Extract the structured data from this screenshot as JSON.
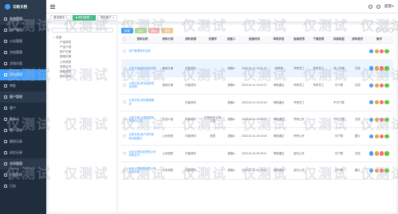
{
  "app": {
    "logo_text": "云帆文档"
  },
  "sidebar": {
    "items": [
      {
        "label": "系统管理",
        "state": "group"
      },
      {
        "label": "用户管理",
        "state": "normal"
      },
      {
        "label": "公告管理",
        "state": "normal"
      },
      {
        "label": "文档管理",
        "state": "normal"
      },
      {
        "label": "文档分类",
        "state": "normal"
      },
      {
        "label": "资料管理",
        "state": "active-sub"
      },
      {
        "label": "审批",
        "state": "normal"
      },
      {
        "label": "客户管理",
        "state": "group"
      },
      {
        "label": "客户",
        "state": "normal"
      },
      {
        "label": "联系人",
        "state": "normal"
      },
      {
        "label": "客户动态",
        "state": "normal"
      },
      {
        "label": "跟进记录",
        "state": "normal"
      },
      {
        "label": "成交记录",
        "state": "normal"
      },
      {
        "label": "合同管理",
        "state": "group"
      },
      {
        "label": "回款管理",
        "state": "normal"
      },
      {
        "label": "日志",
        "state": "normal"
      }
    ]
  },
  "header": {
    "user": "超管A"
  },
  "tabs": [
    {
      "label": "首页首页",
      "active": false
    },
    {
      "label": "资料管理",
      "active": true
    },
    {
      "label": "资料客户",
      "active": false
    }
  ],
  "tree": {
    "search_placeholder": "",
    "nodes": [
      {
        "label": "总部",
        "level": 0
      },
      {
        "label": "产品研发",
        "level": 1
      },
      {
        "label": "产品介绍",
        "level": 1
      },
      {
        "label": "用户手册",
        "level": 1
      },
      {
        "label": "使用手册",
        "level": 1
      },
      {
        "label": "公司资质",
        "level": 1
      },
      {
        "label": "资质证书",
        "level": 1
      },
      {
        "label": "销售资料",
        "level": 1
      },
      {
        "label": "报价资料",
        "level": 1
      }
    ]
  },
  "toolbar": {
    "add": "新增",
    "edit": "修改",
    "delete": "删除",
    "export": "导出"
  },
  "table": {
    "columns": [
      "",
      "资料名称",
      "资料分类",
      "资料来源",
      "关键字",
      "创建人",
      "创建时间",
      "审核状态",
      "查看权限",
      "下载权限",
      "存储类型",
      "资料格式",
      "操作"
    ],
    "rows": [
      [
        "",
        "用户管理操作手册",
        "",
        "",
        "",
        "",
        "",
        "",
        "",
        "",
        "",
        "",
        ""
      ],
      [
        "",
        "云帆文档使用系统说明",
        "使用手册",
        "内部资料",
        "",
        "超管A",
        "2023-02-14 10:31:19",
        "待审核",
        "所有员工",
        "所有员工",
        "线上存储",
        "文档",
        ""
      ],
      [
        "",
        "云帆文档-财务结算项目说明",
        "使用手册",
        "内部资料",
        "",
        "超管A",
        "2023-02-14 10:02:27",
        "审核通过",
        "所有员工",
        "所有员工",
        "可下载",
        "文档",
        ""
      ],
      [
        "",
        "云帆文档-资料管理模块",
        "",
        "内部资料",
        "",
        "超管A",
        "2023-02-14 10:02:18",
        "审核通过",
        "所有员工",
        "",
        "不可下载",
        "",
        ""
      ],
      [
        "",
        "云帆文档-文档权限系统操作介绍",
        "产品介绍",
        "内部资料",
        "文档系统 云帆文档",
        "超管A",
        "2023-02-14 10:02:07",
        "审核通过",
        "所有公开",
        "",
        "不可下载",
        "文档",
        ""
      ],
      [
        "",
        "云帆文档-客户资料系统功能展示",
        "公司资质",
        "内部资料",
        "资质",
        "超管A",
        "2023-02-14 10:02:03",
        "审核通过",
        "所有公开",
        "",
        "可下载",
        "图片",
        ""
      ],
      [
        "",
        "北京云帆科技有限公司资质证书",
        "公司资质",
        "内部资料",
        "",
        "超管A",
        "2023-02-14 09:49:11",
        "审核通过",
        "部分公开",
        "",
        "可下载",
        "文档",
        ""
      ],
      [
        "",
        "北京云帆科技有限公司营业执照",
        "公司资质",
        "内部资料",
        "",
        "超管A",
        "2023-02-14 09:48:51",
        "审核通过",
        "部分公开",
        "",
        "可下载",
        "图片",
        ""
      ]
    ]
  },
  "watermark": "仅测试",
  "colors": {
    "primary": "#409eff",
    "sidebar": "#1f2d3d",
    "success": "#67c23a",
    "danger": "#f56c6c",
    "warning": "#e6a23c"
  }
}
